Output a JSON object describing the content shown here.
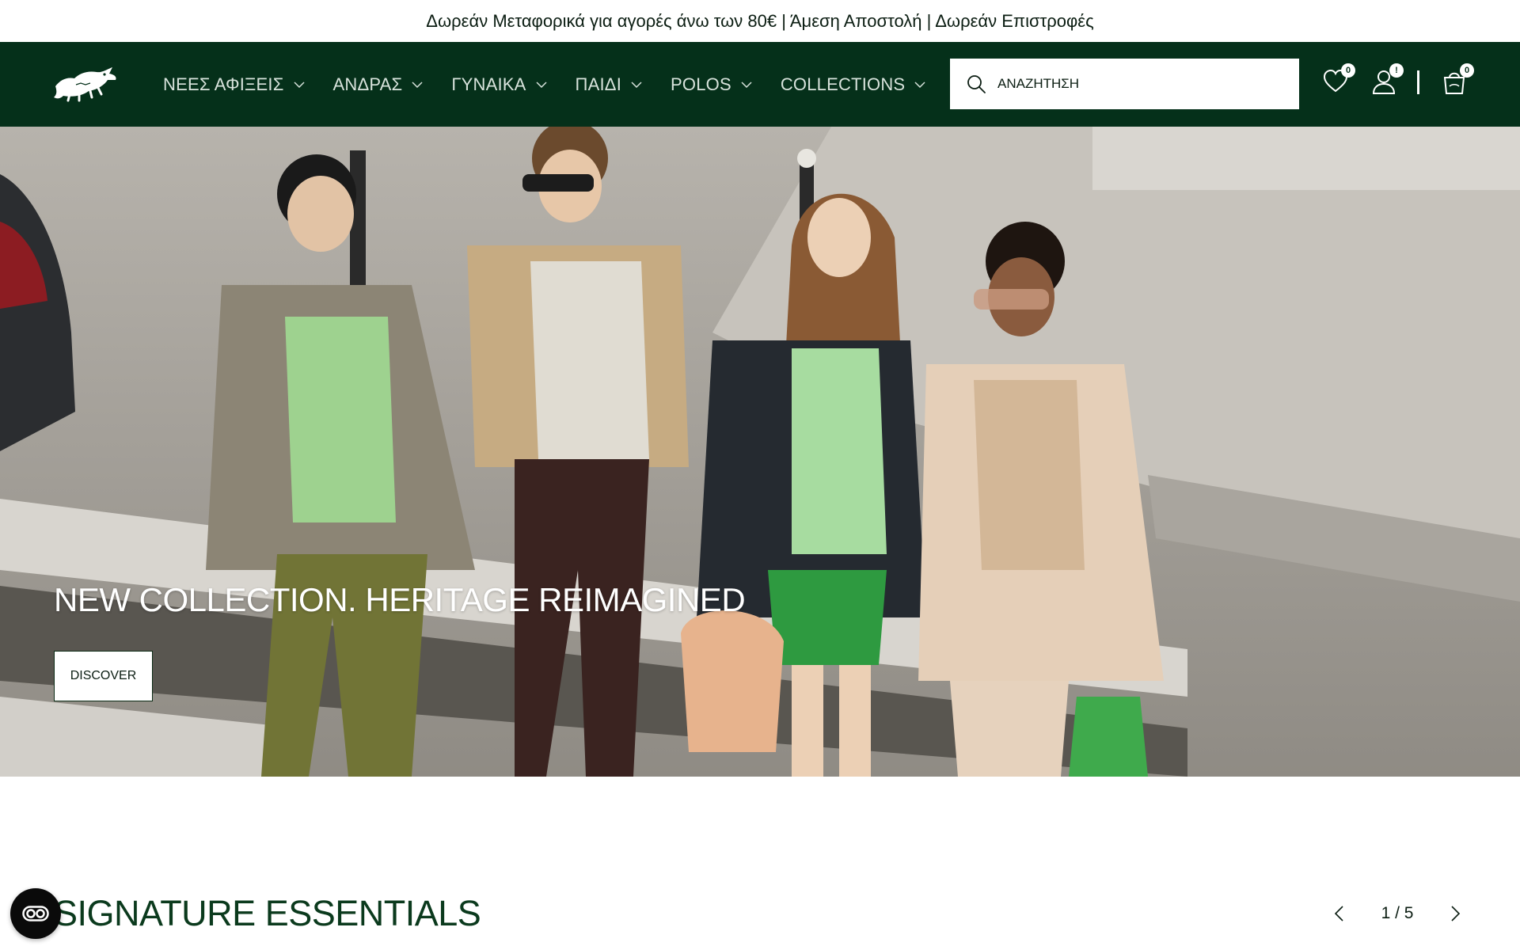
{
  "promo": {
    "text": "Δωρεάν Μεταφορικά για αγορές άνω των 80€ | Άμεση Αποστολή | Δωρεάν Επιστροφές"
  },
  "header": {
    "logo_icon": "crocodile-logo-icon",
    "nav": [
      {
        "label": "ΝΕΕΣ ΑΦΙΞΕΙΣ"
      },
      {
        "label": "ΑΝΔΡΑΣ"
      },
      {
        "label": "ΓΥΝΑΙΚΑ"
      },
      {
        "label": "ΠΑΙΔΙ"
      },
      {
        "label": "POLOS"
      },
      {
        "label": "COLLECTIONS"
      }
    ],
    "search": {
      "placeholder": "ΑΝΑΖΗΤΗΣΗ",
      "icon": "search-icon"
    },
    "wishlist": {
      "icon": "heart-icon",
      "count": "0"
    },
    "account": {
      "icon": "user-icon",
      "badge": "!"
    },
    "cart": {
      "icon": "bag-icon",
      "count": "0"
    }
  },
  "hero": {
    "title": "NEW COLLECTION. HERITAGE REIMAGINED",
    "cta": "DISCOVER"
  },
  "section": {
    "title": "SIGNATURE ESSENTIALS",
    "pager": "1 / 5"
  },
  "colors": {
    "header_bg": "#05301a",
    "brand_green": "#0b3a1d",
    "promo_bg": "#ffffff"
  }
}
